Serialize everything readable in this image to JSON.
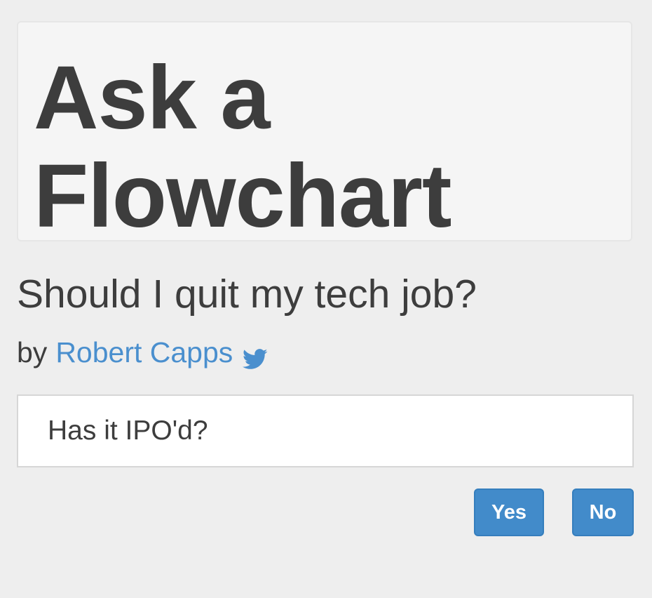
{
  "hero": {
    "title_line1": "Ask a",
    "title_line2": "Flowchart"
  },
  "flowchart": {
    "title": "Should I quit my tech job?",
    "by_label": "by",
    "author": "Robert Capps",
    "author_icon": "twitter-icon"
  },
  "question": {
    "text": "Has it IPO'd?"
  },
  "answers": {
    "yes_label": "Yes",
    "no_label": "No"
  },
  "colors": {
    "background": "#eeeeee",
    "hero_background": "#f5f5f5",
    "text": "#3d3d3d",
    "link": "#4a8fce",
    "button": "#428bca",
    "button_text": "#ffffff"
  }
}
